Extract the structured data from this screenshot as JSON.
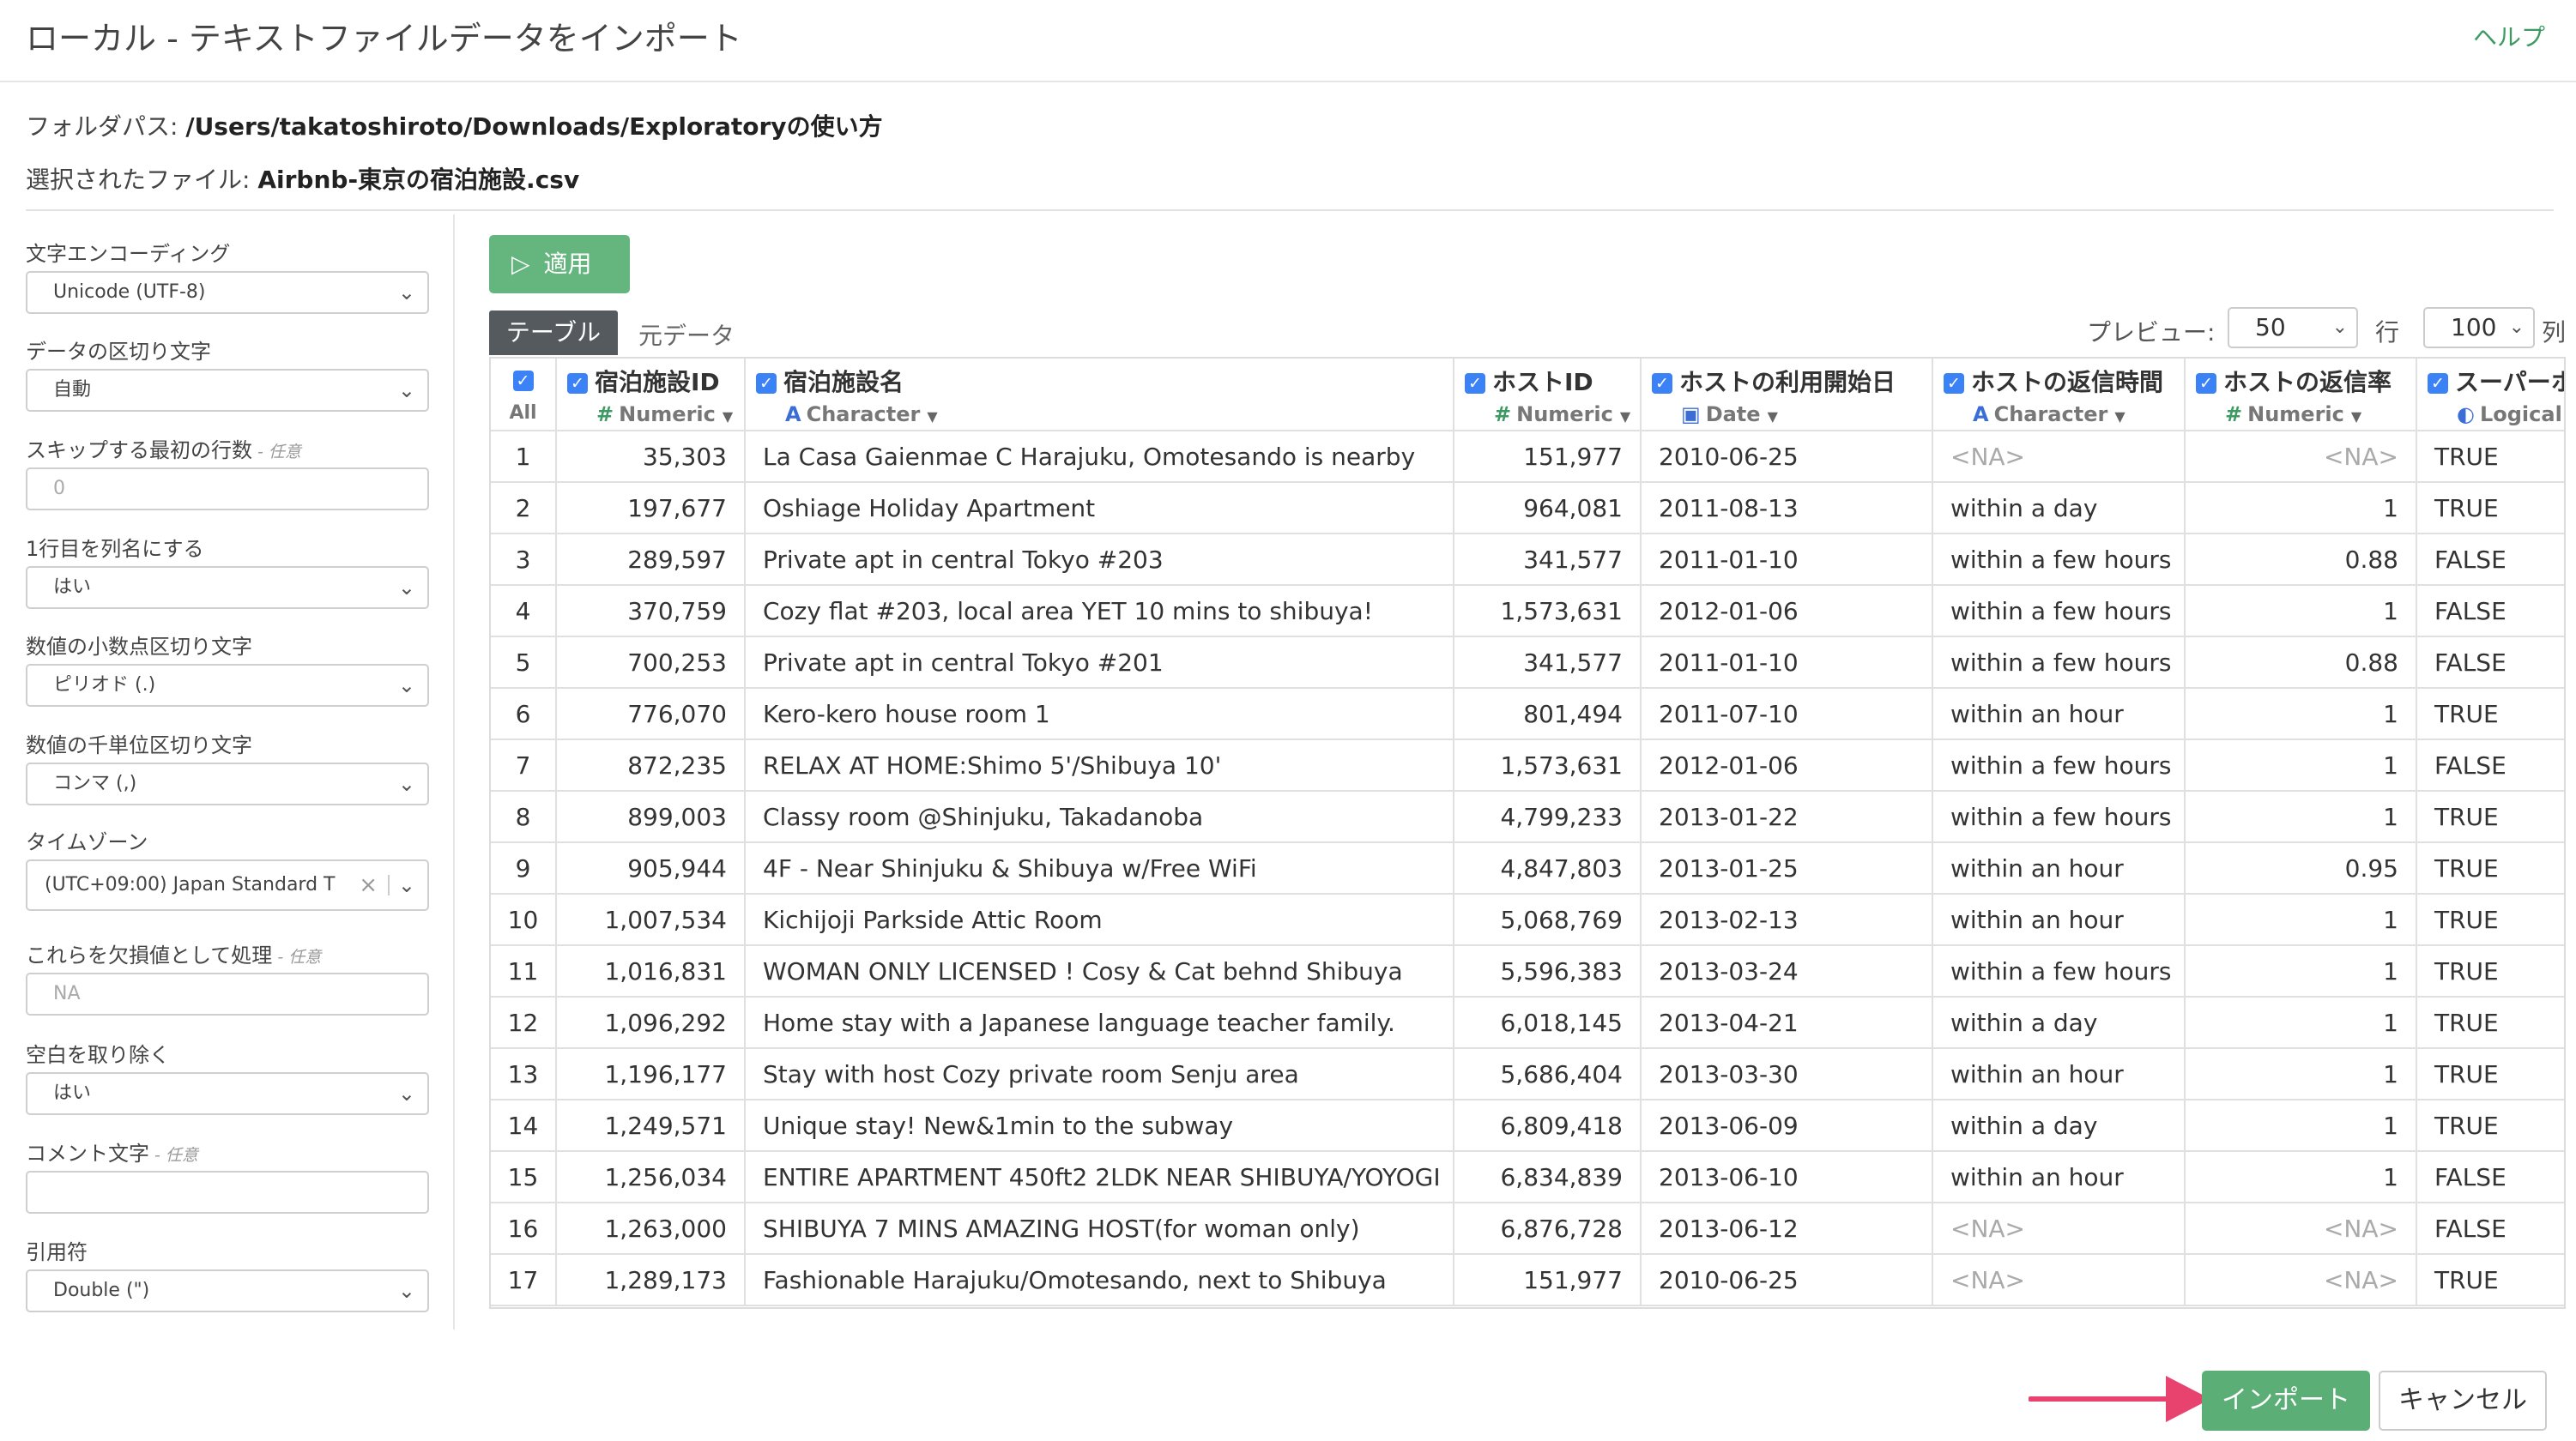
{
  "header": {
    "title": "ローカル - テキストファイルデータをインポート",
    "help": "ヘルプ"
  },
  "info": {
    "folder_label": "フォルダパス: ",
    "folder_value": "/Users/takatoshiroto/Downloads/Exploratoryの使い方",
    "file_label": "選択されたファイル: ",
    "file_value": "Airbnb-東京の宿泊施設.csv"
  },
  "settings": {
    "encoding_label": "文字エンコーディング",
    "encoding_value": "Unicode (UTF-8)",
    "delimiter_label": "データの区切り文字",
    "delimiter_value": "自動",
    "skip_label": "スキップする最初の行数",
    "skip_optional": " - 任意",
    "skip_placeholder": "0",
    "header_label": "1行目を列名にする",
    "header_value": "はい",
    "decimal_label": "数値の小数点区切り文字",
    "decimal_value": "ピリオド (.)",
    "thousands_label": "数値の千単位区切り文字",
    "thousands_value": "コンマ (,)",
    "timezone_label": "タイムゾーン",
    "timezone_value": "(UTC+09:00) Japan Standard T",
    "na_label": "これらを欠損値として処理",
    "na_optional": " - 任意",
    "na_placeholder": "NA",
    "trim_label": "空白を取り除く",
    "trim_value": "はい",
    "comment_label": "コメント文字",
    "comment_optional": " - 任意",
    "quote_label": "引用符",
    "quote_value": "Double (\")"
  },
  "toolbar": {
    "apply": "適用",
    "tab_table": "テーブル",
    "tab_raw": "元データ",
    "preview_label": "プレビュー:",
    "preview_rows": "50",
    "rows_unit": "行",
    "preview_cols": "100",
    "cols_unit": "列"
  },
  "table": {
    "all_label": "All",
    "columns": [
      {
        "name": "宿泊施設ID",
        "type": "Numeric",
        "type_icon": "#"
      },
      {
        "name": "宿泊施設名",
        "type": "Character",
        "type_icon": "A"
      },
      {
        "name": "ホストID",
        "type": "Numeric",
        "type_icon": "#"
      },
      {
        "name": "ホストの利用開始日",
        "type": "Date",
        "type_icon": "calendar"
      },
      {
        "name": "ホストの返信時間",
        "type": "Character",
        "type_icon": "A"
      },
      {
        "name": "ホストの返信率",
        "type": "Numeric",
        "type_icon": "#"
      },
      {
        "name": "スーパーホ",
        "type": "Logical",
        "type_icon": "toggle"
      }
    ],
    "rows": [
      [
        "1",
        "35,303",
        "La Casa Gaienmae C Harajuku, Omotesando is nearby",
        "151,977",
        "2010-06-25",
        "<NA>",
        "<NA>",
        "TRUE"
      ],
      [
        "2",
        "197,677",
        "Oshiage Holiday Apartment",
        "964,081",
        "2011-08-13",
        "within a day",
        "1",
        "TRUE"
      ],
      [
        "3",
        "289,597",
        "Private apt in central Tokyo #203",
        "341,577",
        "2011-01-10",
        "within a few hours",
        "0.88",
        "FALSE"
      ],
      [
        "4",
        "370,759",
        "Cozy flat #203, local area YET 10 mins to shibuya!",
        "1,573,631",
        "2012-01-06",
        "within a few hours",
        "1",
        "FALSE"
      ],
      [
        "5",
        "700,253",
        "Private apt in central Tokyo #201",
        "341,577",
        "2011-01-10",
        "within a few hours",
        "0.88",
        "FALSE"
      ],
      [
        "6",
        "776,070",
        "Kero-kero house room 1",
        "801,494",
        "2011-07-10",
        "within an hour",
        "1",
        "TRUE"
      ],
      [
        "7",
        "872,235",
        "RELAX AT HOME:Shimo 5'/Shibuya 10'",
        "1,573,631",
        "2012-01-06",
        "within a few hours",
        "1",
        "FALSE"
      ],
      [
        "8",
        "899,003",
        "Classy room @Shinjuku, Takadanoba",
        "4,799,233",
        "2013-01-22",
        "within a few hours",
        "1",
        "TRUE"
      ],
      [
        "9",
        "905,944",
        "4F - Near Shinjuku & Shibuya w/Free WiFi",
        "4,847,803",
        "2013-01-25",
        "within an hour",
        "0.95",
        "TRUE"
      ],
      [
        "10",
        "1,007,534",
        "Kichijoji Parkside Attic Room",
        "5,068,769",
        "2013-02-13",
        "within an hour",
        "1",
        "TRUE"
      ],
      [
        "11",
        "1,016,831",
        "WOMAN ONLY LICENSED ! Cosy & Cat behnd Shibuya",
        "5,596,383",
        "2013-03-24",
        "within a few hours",
        "1",
        "TRUE"
      ],
      [
        "12",
        "1,096,292",
        "Home stay with a Japanese language teacher family.",
        "6,018,145",
        "2013-04-21",
        "within a day",
        "1",
        "TRUE"
      ],
      [
        "13",
        "1,196,177",
        "Stay with host Cozy private room Senju area",
        "5,686,404",
        "2013-03-30",
        "within an hour",
        "1",
        "TRUE"
      ],
      [
        "14",
        "1,249,571",
        "Unique stay! New&1min to the subway",
        "6,809,418",
        "2013-06-09",
        "within a day",
        "1",
        "TRUE"
      ],
      [
        "15",
        "1,256,034",
        "ENTIRE APARTMENT 450ft2 2LDK NEAR SHIBUYA/YOYOGI",
        "6,834,839",
        "2013-06-10",
        "within an hour",
        "1",
        "FALSE"
      ],
      [
        "16",
        "1,263,000",
        "SHIBUYA 7 MINS AMAZING HOST(for woman only)",
        "6,876,728",
        "2013-06-12",
        "<NA>",
        "<NA>",
        "FALSE"
      ],
      [
        "17",
        "1,289,173",
        "Fashionable Harajuku/Omotesando, next to Shibuya",
        "151,977",
        "2010-06-25",
        "<NA>",
        "<NA>",
        "TRUE"
      ]
    ]
  },
  "footer": {
    "import": "インポート",
    "cancel": "キャンセル"
  },
  "colors": {
    "accent_green": "#5cae77",
    "checkbox_blue": "#3b82f6",
    "arrow_pink": "#e8436f"
  }
}
